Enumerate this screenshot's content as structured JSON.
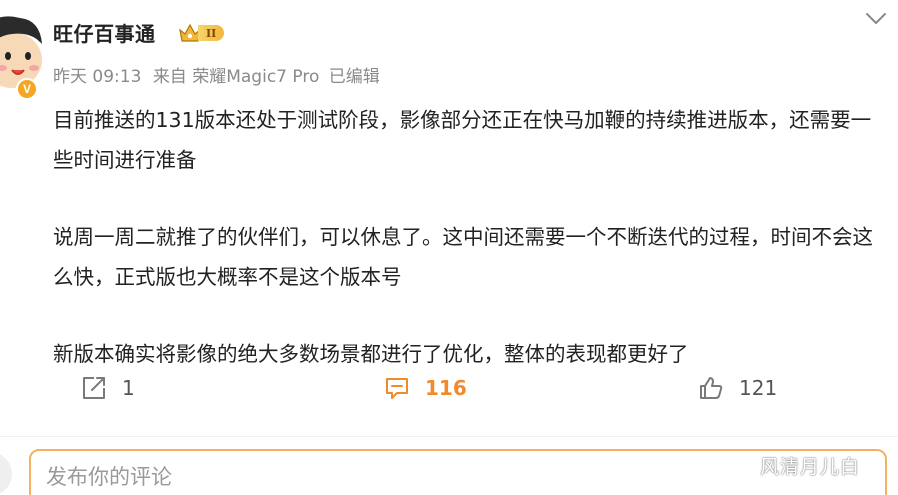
{
  "author": {
    "name": "旺仔百事通",
    "badge_level": "II",
    "verified_mark": "V"
  },
  "meta": {
    "time": "昨天 09:13",
    "source": "来自 荣耀Magic7 Pro",
    "edited": "已编辑"
  },
  "post": {
    "paragraphs": [
      "目前推送的131版本还处于测试阶段，影像部分还正在快马加鞭的持续推进版本，还需要一些时间进行准备",
      "说周一周二就推了的伙伴们，可以休息了。这中间还需要一个不断迭代的过程，时间不会这么快，正式版也大概率不是这个版本号",
      "新版本确实将影像的绝大多数场景都进行了优化，整体的表现都更好了"
    ]
  },
  "actions": {
    "repost_count": "1",
    "comment_count": "116",
    "like_count": "121"
  },
  "composer": {
    "placeholder": "发布你的评论"
  },
  "watermark": "风清月儿白",
  "icons": {
    "more": "chevron-down-icon",
    "repost": "share-icon",
    "comment": "comment-icon",
    "like": "thumbs-up-icon"
  },
  "colors": {
    "accent": "#f08a2a",
    "badge": "#f5a623",
    "meta_text": "#8a8a8a"
  }
}
